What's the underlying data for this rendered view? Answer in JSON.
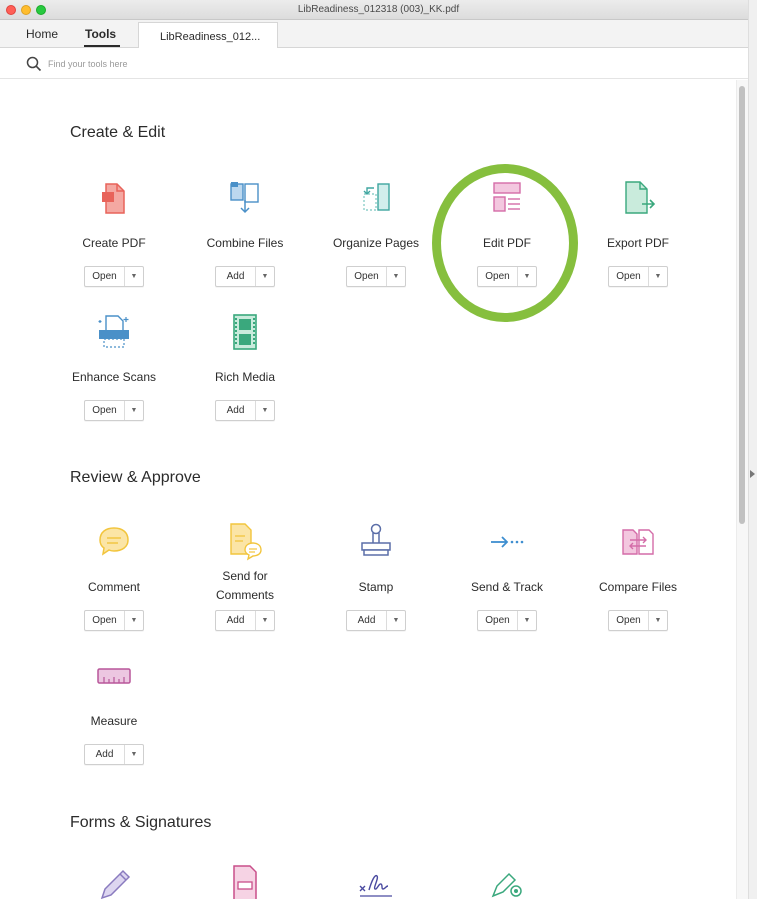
{
  "window": {
    "title": "LibReadiness_012318 (003)_KK.pdf"
  },
  "tabs": {
    "home": "Home",
    "tools": "Tools",
    "document": "LibReadiness_012..."
  },
  "search": {
    "placeholder": "Find your tools here",
    "icon": "search-icon"
  },
  "sections": [
    {
      "title": "Create & Edit",
      "tools": [
        {
          "label": "Create PDF",
          "action": "Open",
          "icon": "create-pdf-icon",
          "color": "#e8635a"
        },
        {
          "label": "Combine Files",
          "action": "Add",
          "icon": "combine-files-icon",
          "color": "#4a90c8"
        },
        {
          "label": "Organize Pages",
          "action": "Open",
          "icon": "organize-pages-icon",
          "color": "#3fa6a0"
        },
        {
          "label": "Edit PDF",
          "action": "Open",
          "icon": "edit-pdf-icon",
          "color": "#d46ca8",
          "highlighted": true
        },
        {
          "label": "Export PDF",
          "action": "Open",
          "icon": "export-pdf-icon",
          "color": "#3aa87d"
        },
        {
          "label": "Enhance Scans",
          "action": "Open",
          "icon": "enhance-scans-icon",
          "color": "#4a90c8"
        },
        {
          "label": "Rich Media",
          "action": "Add",
          "icon": "rich-media-icon",
          "color": "#3aa87d"
        }
      ]
    },
    {
      "title": "Review & Approve",
      "tools": [
        {
          "label": "Comment",
          "action": "Open",
          "icon": "comment-icon",
          "color": "#f2c53d"
        },
        {
          "label": "Send for Comments",
          "label_line1": "Send for",
          "label_line2": "Comments",
          "action": "Add",
          "icon": "send-for-comments-icon",
          "color": "#f2c53d"
        },
        {
          "label": "Stamp",
          "action": "Add",
          "icon": "stamp-icon",
          "color": "#5b6ea8"
        },
        {
          "label": "Send & Track",
          "action": "Open",
          "icon": "send-track-icon",
          "color": "#3e8ed0"
        },
        {
          "label": "Compare Files",
          "action": "Open",
          "icon": "compare-files-icon",
          "color": "#d46ca8"
        },
        {
          "label": "Measure",
          "action": "Add",
          "icon": "measure-icon",
          "color": "#b8569a"
        }
      ]
    },
    {
      "title": "Forms & Signatures",
      "tools": [
        {
          "icon": "fill-sign-icon",
          "color": "#8a7bbf"
        },
        {
          "icon": "prepare-form-icon",
          "color": "#c94f8a"
        },
        {
          "icon": "send-for-signature-icon",
          "color": "#4a4aa0"
        },
        {
          "icon": "certificates-icon",
          "color": "#3aa87d"
        }
      ]
    }
  ],
  "highlight_color": "#86bf3e"
}
